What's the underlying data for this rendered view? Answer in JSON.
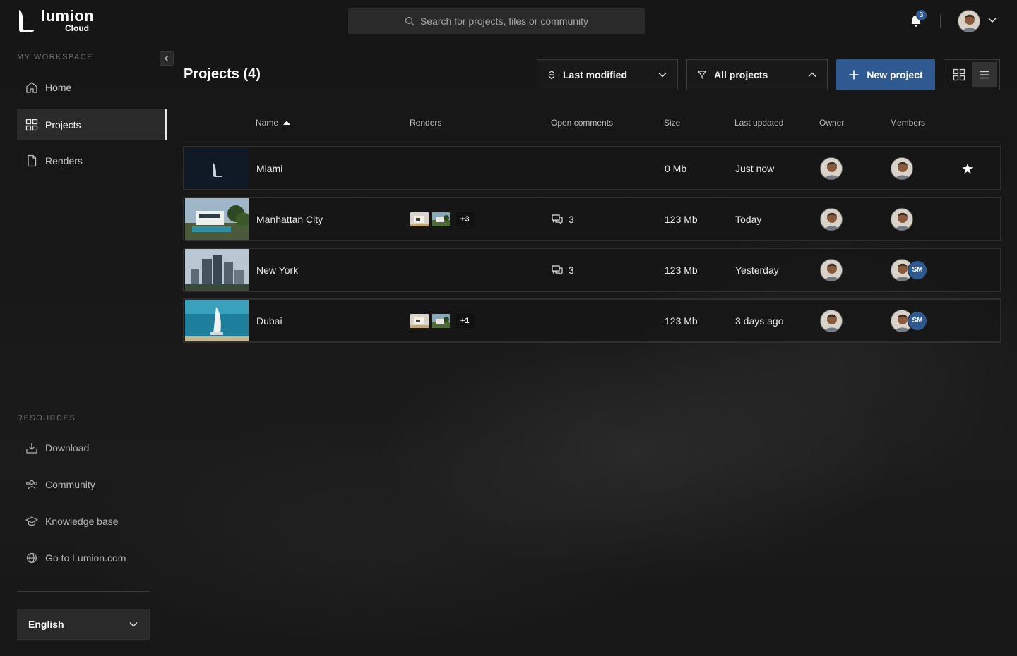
{
  "app": {
    "name": "lumion",
    "sub": "Cloud"
  },
  "search": {
    "placeholder": "Search for projects, files or community"
  },
  "notifications": {
    "count": "3"
  },
  "sidebar": {
    "workspace_label": "MY WORKSPACE",
    "items": [
      {
        "label": "Home",
        "icon": "home-icon"
      },
      {
        "label": "Projects",
        "icon": "grid-icon",
        "active": true
      },
      {
        "label": "Renders",
        "icon": "file-icon"
      }
    ],
    "resources_label": "RESOURCES",
    "resources": [
      {
        "label": "Download",
        "icon": "download-icon"
      },
      {
        "label": "Community",
        "icon": "community-icon"
      },
      {
        "label": "Knowledge base",
        "icon": "graduation-cap-icon"
      },
      {
        "label": "Go to Lumion.com",
        "icon": "globe-icon"
      }
    ],
    "language": "English"
  },
  "main": {
    "title": "Projects (4)",
    "sort_label": "Last modified",
    "filter_label": "All projects",
    "new_project_label": "New project",
    "columns": [
      "Name",
      "Renders",
      "Open comments",
      "Size",
      "Last updated",
      "Owner",
      "Members"
    ],
    "rows": [
      {
        "name": "Miami",
        "renders_more": "",
        "comments": "",
        "size": "0 Mb",
        "updated": "Just now",
        "member_initials": "",
        "favorite": true
      },
      {
        "name": "Manhattan City",
        "renders_more": "+3",
        "comments": "3",
        "size": "123 Mb",
        "updated": "Today",
        "member_initials": "",
        "favorite": false
      },
      {
        "name": "New York",
        "renders_more": "",
        "comments": "3",
        "size": "123 Mb",
        "updated": "Yesterday",
        "member_initials": "SM",
        "favorite": false
      },
      {
        "name": "Dubai",
        "renders_more": "+1",
        "comments": "",
        "size": "123 Mb",
        "updated": "3 days ago",
        "member_initials": "SM",
        "favorite": false
      }
    ]
  },
  "colors": {
    "accent": "#2f5a91",
    "background": "#131313",
    "panel": "#2a2a2a"
  }
}
